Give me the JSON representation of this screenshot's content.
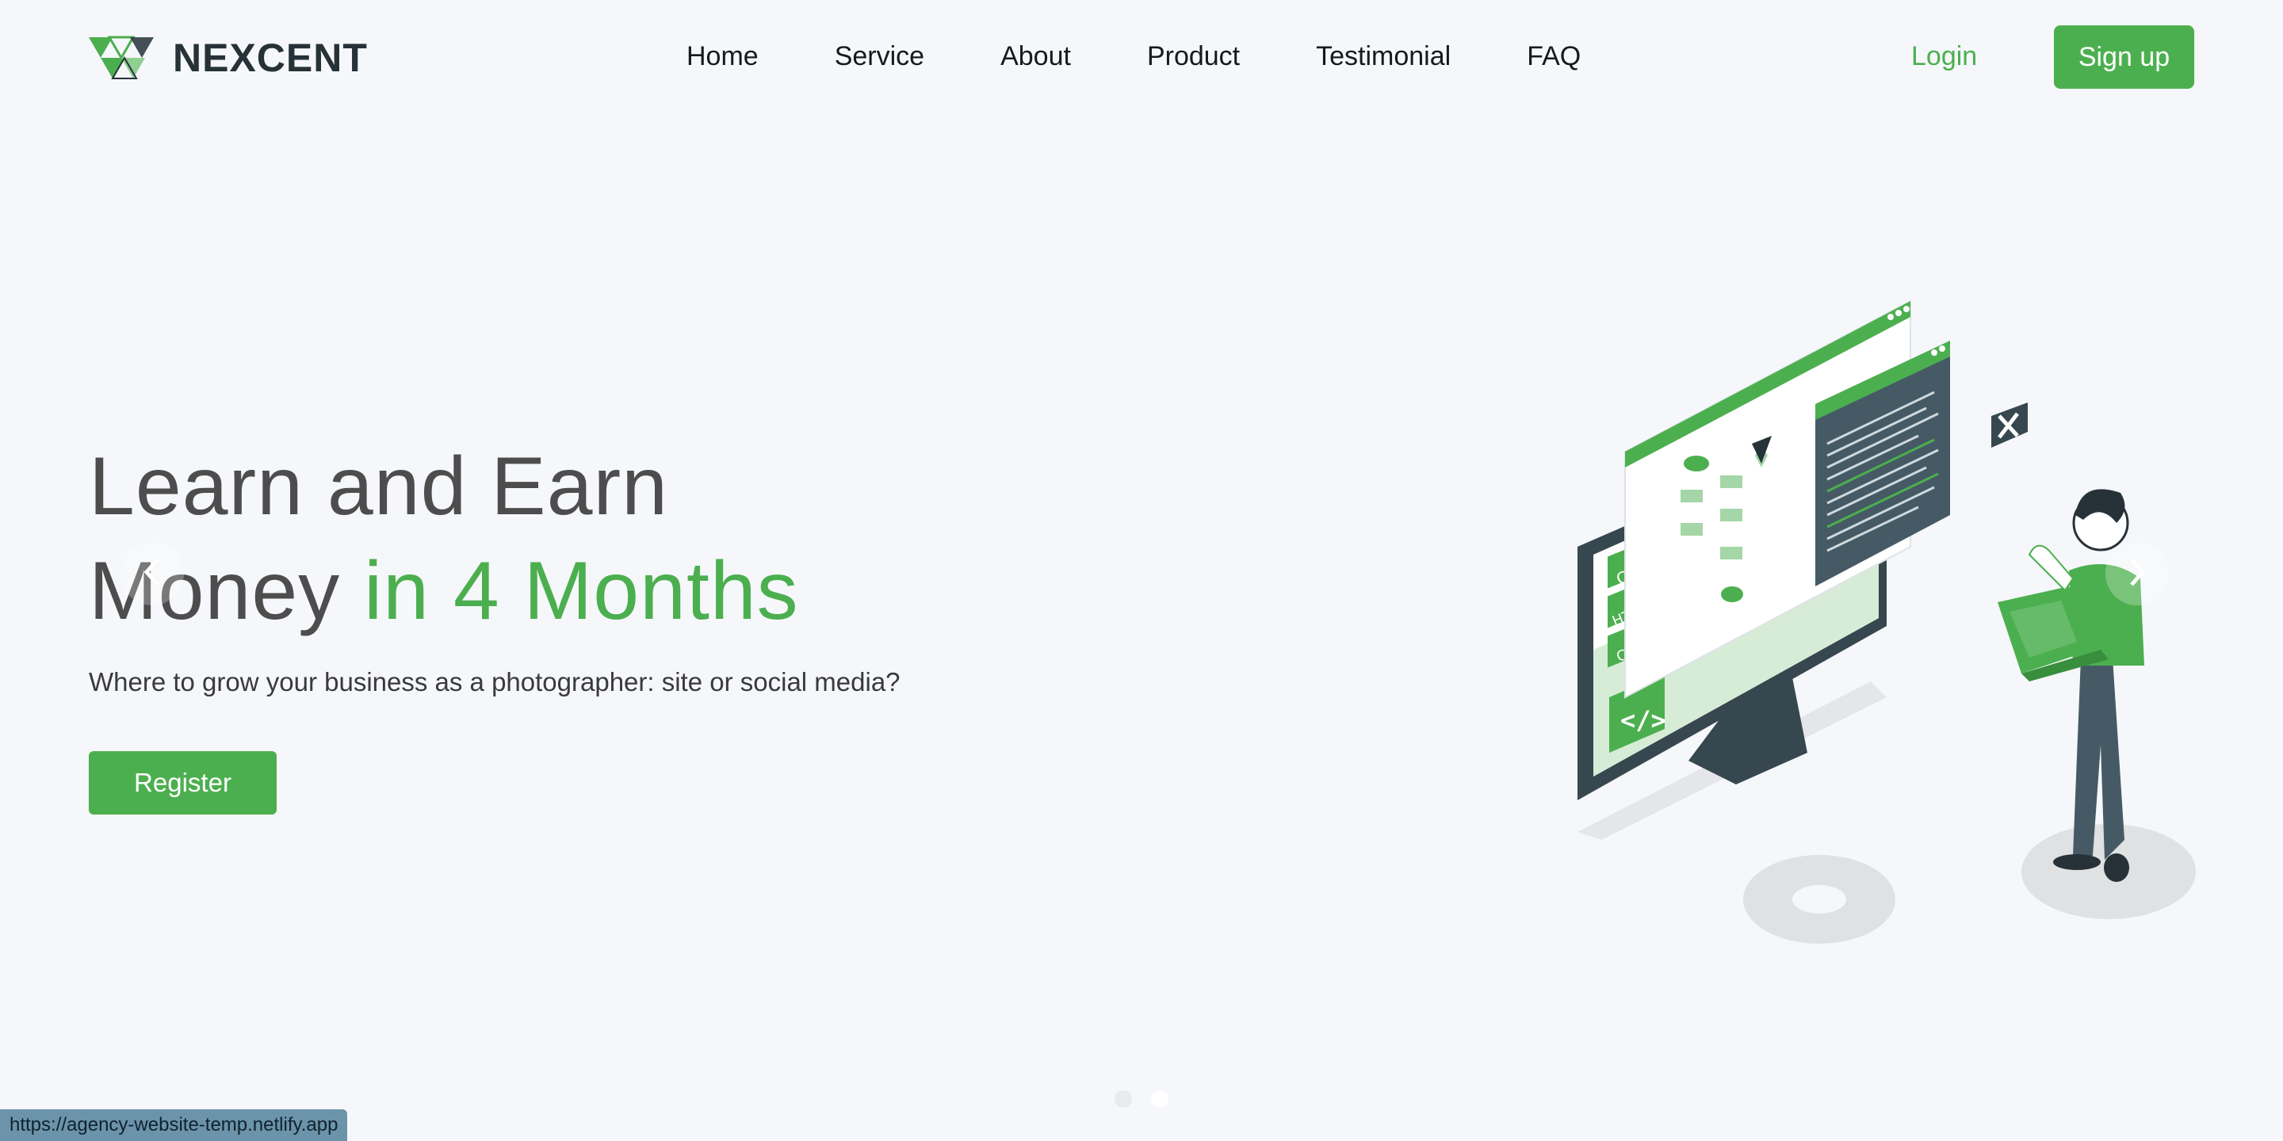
{
  "brand": {
    "name": "NEXCENT"
  },
  "nav": {
    "items": [
      {
        "label": "Home",
        "active": true
      },
      {
        "label": "Service"
      },
      {
        "label": "About"
      },
      {
        "label": "Product"
      },
      {
        "label": "Testimonial"
      },
      {
        "label": "FAQ"
      }
    ],
    "login_label": "Login",
    "signup_label": "Sign up"
  },
  "hero": {
    "title_line1": "Learn and Earn",
    "title_line2_plain": "Money",
    "title_line2_accent": "in 4 Months",
    "subtitle": "Where to grow your business as a photographer: site or social media?",
    "register_label": "Register",
    "illustration_labels": [
      "CSS",
      "HTML",
      "C++"
    ]
  },
  "carousel": {
    "prev_icon": "chevron-left-icon",
    "next_icon": "chevron-right-icon",
    "slide_count": 2,
    "active_index": 1
  },
  "status_bar": {
    "url": "https://agency-website-temp.netlify.app"
  },
  "colors": {
    "brand_green": "#4caf4f",
    "text_dark": "#263238",
    "heading_gray": "#4d4d4d",
    "background": "#f5f7fa"
  }
}
